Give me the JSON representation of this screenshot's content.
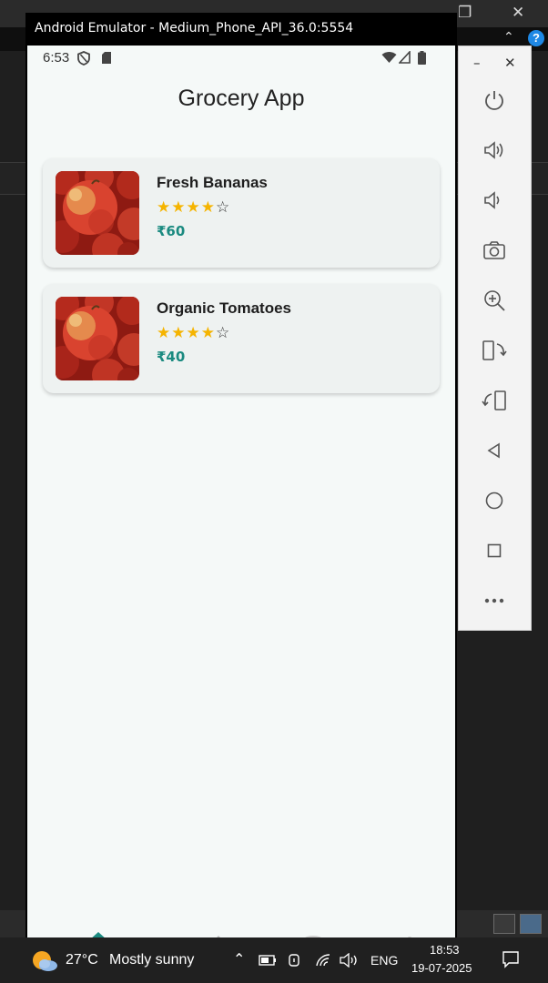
{
  "emulator": {
    "title": "Android Emulator - Medium_Phone_API_36.0:5554"
  },
  "status_bar": {
    "time": "6:53"
  },
  "app": {
    "title": "Grocery App",
    "products": [
      {
        "name": "Fresh Bananas",
        "rating": 4,
        "max_rating": 5,
        "price": "₹60"
      },
      {
        "name": "Organic Tomatoes",
        "rating": 4,
        "max_rating": 5,
        "price": "₹40"
      }
    ]
  },
  "toolbar": {
    "items": [
      "power-icon",
      "volume-up-icon",
      "volume-down-icon",
      "camera-icon",
      "zoom-icon",
      "rotate-left-icon",
      "rotate-right-icon",
      "back-icon",
      "home-icon",
      "overview-icon",
      "more-icon"
    ]
  },
  "taskbar": {
    "temperature": "27°C",
    "weather": "Mostly sunny",
    "language": "ENG",
    "time": "18:53",
    "date": "19-07-2025"
  },
  "colors": {
    "accent": "#1a8a80",
    "star": "#f5b400",
    "help_badge": "#1e88e5"
  }
}
